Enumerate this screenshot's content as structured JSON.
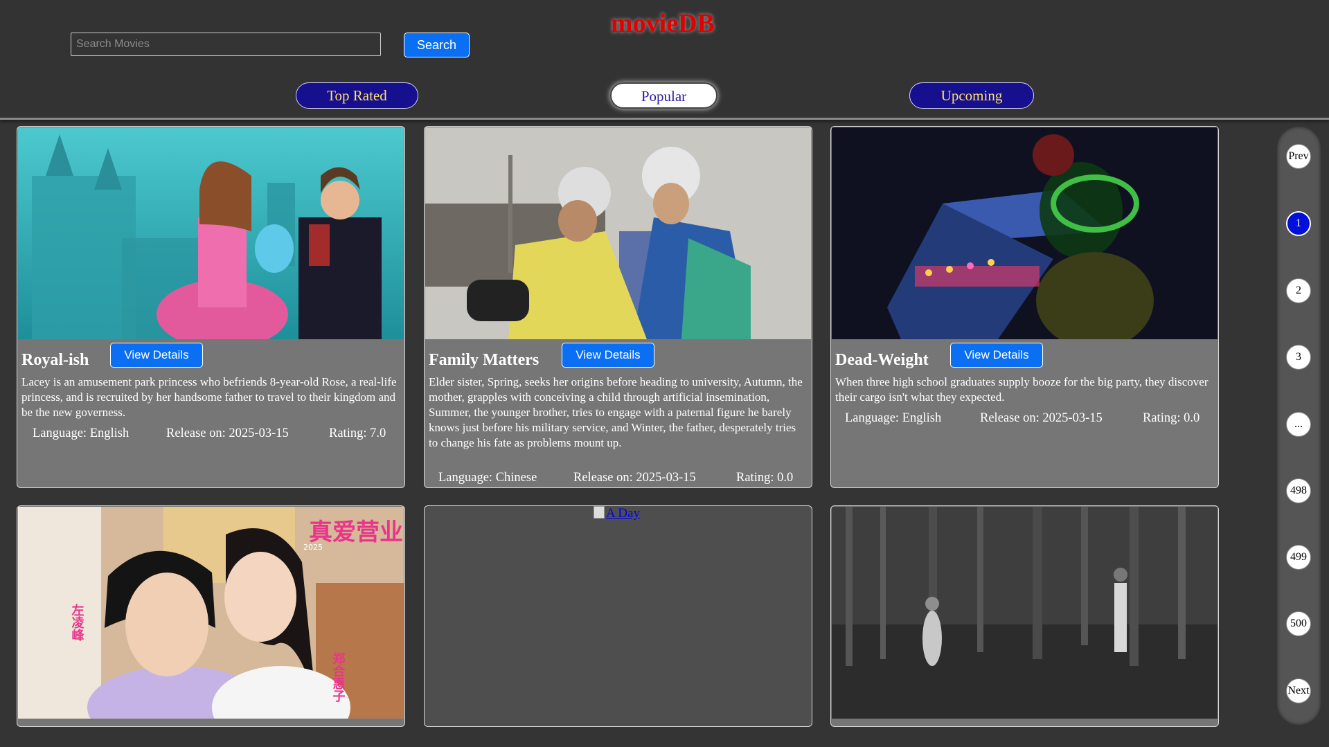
{
  "header": {
    "site_title": "movieDB",
    "search_placeholder": "Search Movies",
    "search_button": "Search",
    "tabs": [
      {
        "label": "Top Rated",
        "active": false
      },
      {
        "label": "Popular",
        "active": true
      },
      {
        "label": "Upcoming",
        "active": false
      }
    ]
  },
  "movies": [
    {
      "title": "Royal-ish",
      "details_label": "View Details",
      "overview": "Lacey is an amusement park princess who befriends 8-year-old Rose, a real-life princess, and is recruited by her handsome father to travel to their kingdom and be the new governess.",
      "language": "Language: English",
      "release": "Release on: 2025-03-15",
      "rating": "Rating: 7.0"
    },
    {
      "title": "Family Matters",
      "details_label": "View Details",
      "overview": "Elder sister, Spring, seeks her origins before heading to university, Autumn, the mother, grapples with conceiving a child through artificial insemination, Summer, the younger brother, tries to engage with a paternal figure he barely knows just before his military service, and Winter, the father, desperately tries to change his fate as problems mount up.",
      "language": "Language: Chinese",
      "release": "Release on: 2025-03-15",
      "rating": "Rating: 0.0"
    },
    {
      "title": "Dead-Weight",
      "details_label": "View Details",
      "overview": "When three high school graduates supply booze for the big party, they discover their cargo isn't what they expected.",
      "language": "Language: English",
      "release": "Release on: 2025-03-15",
      "rating": "Rating: 0.0"
    },
    {
      "poster_text": [
        "真爱营业",
        "2025",
        "左凌峰",
        "郑合惠子"
      ]
    },
    {
      "broken_image_alt": "A Day"
    },
    {}
  ],
  "pagination": {
    "prev": "Prev",
    "pages": [
      "1",
      "2",
      "3",
      "...",
      "498",
      "499",
      "500"
    ],
    "active_page": "1",
    "next": "Next"
  },
  "colors": {
    "background": "#343434",
    "title_red": "#e00000",
    "button_blue": "#0a6ff2",
    "tab_navy": "#160f8e",
    "tab_text_yellow": "#ffe066",
    "card_gray": "#767676",
    "active_page_blue": "#0010d8"
  }
}
